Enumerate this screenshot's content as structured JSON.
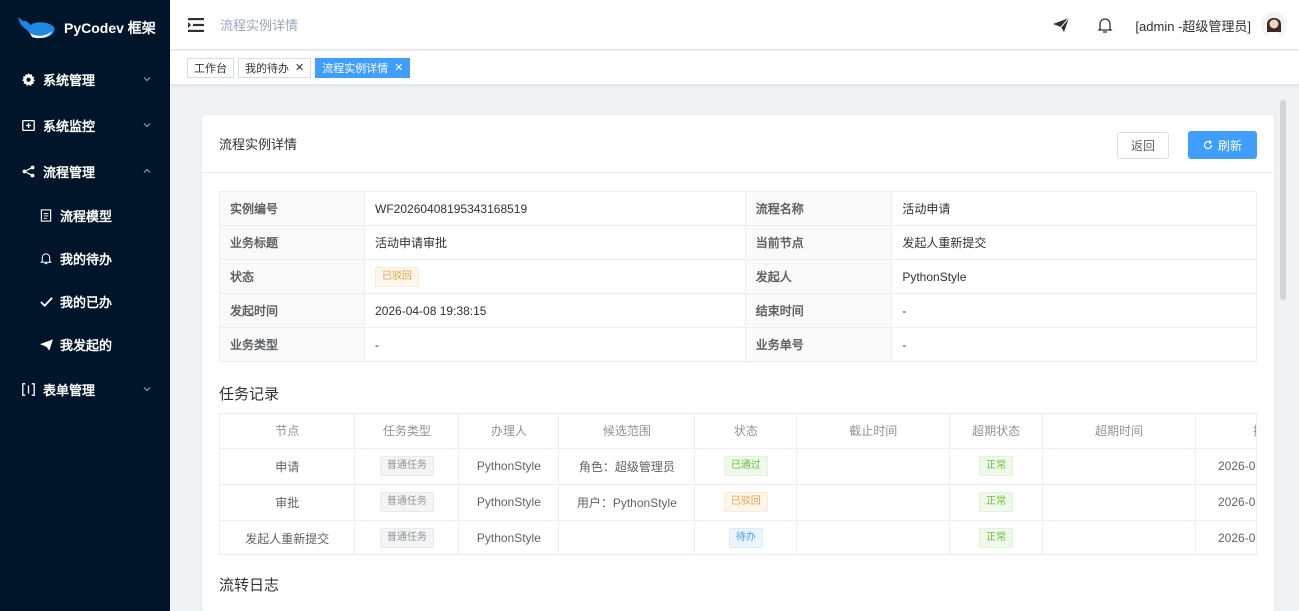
{
  "app": {
    "logo_text": "PyCodev 框架"
  },
  "sidebar": {
    "items": [
      {
        "label": "系统管理"
      },
      {
        "label": "系统监控"
      },
      {
        "label": "流程管理"
      },
      {
        "label": "表单管理"
      }
    ],
    "sub_items": [
      {
        "label": "流程模型"
      },
      {
        "label": "我的待办"
      },
      {
        "label": "我的已办"
      },
      {
        "label": "我发起的"
      }
    ]
  },
  "header": {
    "breadcrumb": "流程实例详情",
    "user": "[admin -超级管理员]"
  },
  "tags": [
    {
      "label": "工作台"
    },
    {
      "label": "我的待办"
    },
    {
      "label": "流程实例详情"
    }
  ],
  "card": {
    "title": "流程实例详情",
    "back_label": "返回",
    "refresh_label": "刷新"
  },
  "details": {
    "instance_no_label": "实例编号",
    "instance_no": "WF20260408195343168519",
    "process_name_label": "流程名称",
    "process_name": "活动申请",
    "biz_title_label": "业务标题",
    "biz_title": "活动申请审批",
    "current_node_label": "当前节点",
    "current_node": "发起人重新提交",
    "status_label": "状态",
    "status": "已驳回",
    "initiator_label": "发起人",
    "initiator": "PythonStyle",
    "start_time_label": "发起时间",
    "start_time": "2026-04-08 19:38:15",
    "end_time_label": "结束时间",
    "end_time": "-",
    "biz_type_label": "业务类型",
    "biz_type": "-",
    "biz_no_label": "业务单号",
    "biz_no": "-"
  },
  "tasks_section": {
    "title": "任务记录",
    "columns": [
      "节点",
      "任务类型",
      "办理人",
      "候选范围",
      "状态",
      "截止时间",
      "超期状态",
      "超期时间",
      "接"
    ],
    "rows": [
      {
        "node": "申请",
        "type": "普通任务",
        "assignee": "PythonStyle",
        "scope": "角色：超级管理员",
        "status": "已通过",
        "deadline": "",
        "overdue": "正常",
        "overdue_time": "",
        "time": "2026-0"
      },
      {
        "node": "审批",
        "type": "普通任务",
        "assignee": "PythonStyle",
        "scope": "用户：PythonStyle",
        "status": "已驳回",
        "deadline": "",
        "overdue": "正常",
        "overdue_time": "",
        "time": "2026-0"
      },
      {
        "node": "发起人重新提交",
        "type": "普通任务",
        "assignee": "PythonStyle",
        "scope": "",
        "status": "待办",
        "deadline": "",
        "overdue": "正常",
        "overdue_time": "",
        "time": "2026-0"
      }
    ]
  },
  "log_section": {
    "title": "流转日志"
  },
  "colors": {
    "sidebar_bg": "#001529",
    "primary": "#409eff",
    "warning": "#e6a23c",
    "success": "#67c23a"
  }
}
